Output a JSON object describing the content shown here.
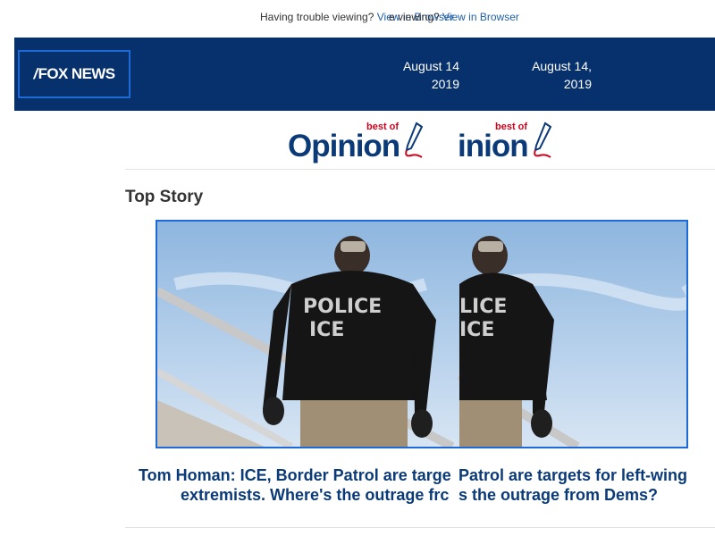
{
  "preheader": {
    "left_text": "Having trouble viewing?",
    "left_link": "View in Browser",
    "right_text": "e viewing?",
    "right_link": "View in Browser"
  },
  "header": {
    "logo_text": "FOX NEWS",
    "logo_slash": "/",
    "date_left": "August 14\n2019",
    "date_right": "August 14,\n2019"
  },
  "banner": {
    "best_of": "best of",
    "opinion_left": "Opinion",
    "opinion_right": "inion"
  },
  "section": {
    "title": "Top Story"
  },
  "story": {
    "image_alt": "Man in POLICE ICE jacket descending aircraft stairs",
    "jacket_text_1": "POLICE",
    "jacket_text_2": "ICE",
    "jacket_text_1_cut": "LICE",
    "headline_line1_left": "Tom Homan: ICE, Border Patrol are targe",
    "headline_line1_right": "Patrol are targets for left-wing",
    "headline_line2_left": "extremists. Where's the outrage frc",
    "headline_line2_right": "s the outrage from Dems?"
  },
  "colors": {
    "header_bg": "#07316c",
    "link": "#1f5fa8",
    "headline": "#0b3a78",
    "accent_red": "#d0021b",
    "focus_border": "#1d6ad6"
  }
}
